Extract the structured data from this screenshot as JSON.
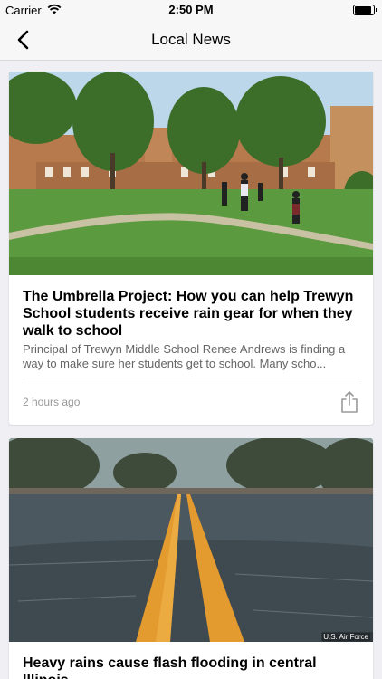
{
  "status_bar": {
    "carrier": "Carrier",
    "time": "2:50 PM",
    "wifi_icon": "wifi-icon",
    "battery_icon": "battery-icon"
  },
  "nav": {
    "title": "Local News",
    "back_icon": "chevron-left-icon"
  },
  "articles": [
    {
      "headline": "The Umbrella Project: How you can help Trewyn School students receive rain gear for when they walk to school",
      "summary": "Principal of Trewyn Middle School Renee Andrews is finding a way to make sure her students get to school. Many scho...",
      "timestamp": "2 hours ago",
      "share_icon": "share-icon",
      "image": "school-campus-photo"
    },
    {
      "headline": "Heavy rains cause flash flooding in central Illinois",
      "image": "flooded-road-photo",
      "image_credit": "U.S. Air Force"
    }
  ],
  "colors": {
    "background": "#efeff4",
    "bar": "#f7f7f7",
    "summary_text": "#666666",
    "meta_text": "#999999"
  }
}
